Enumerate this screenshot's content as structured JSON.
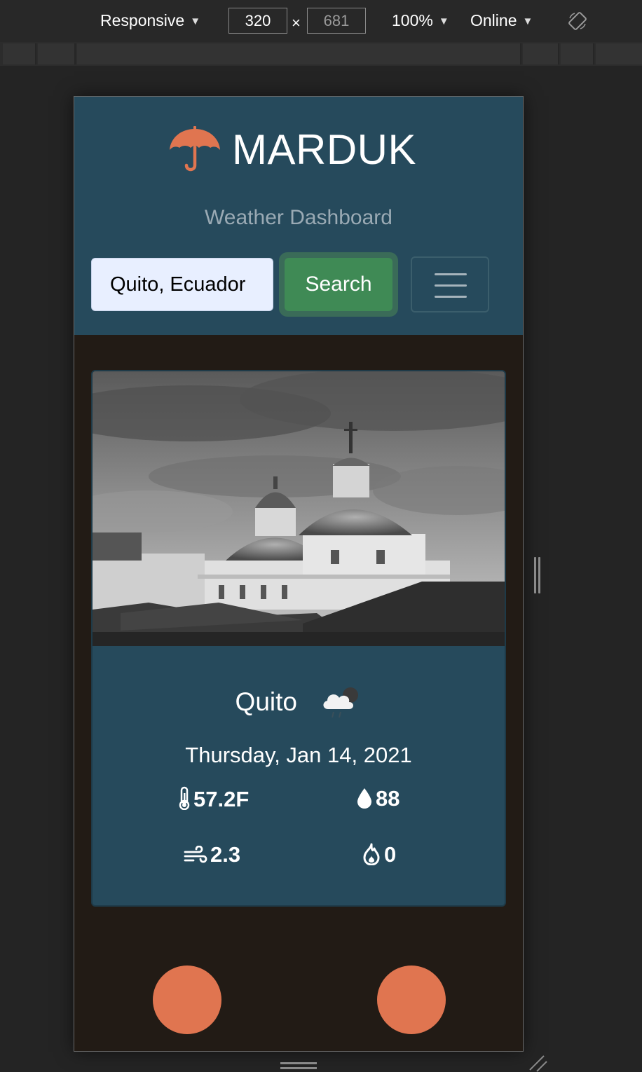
{
  "devtools": {
    "device_mode": "Responsive",
    "width": "320",
    "height": "681",
    "times": "×",
    "zoom": "100%",
    "network": "Online",
    "rotate_icon": "rotate-icon",
    "caret_icon": "▼"
  },
  "header": {
    "logo_icon": "umbrella-icon",
    "brand": "MARDUK",
    "subtitle": "Weather Dashboard",
    "search_value": "Quito, Ecuador",
    "search_button": "Search",
    "menu_icon": "hamburger-icon"
  },
  "weather": {
    "city": "Quito",
    "condition_icon": "cloud-rain-icon",
    "date": "Thursday, Jan 14, 2021",
    "temperature": "57.2F",
    "humidity": "88",
    "wind": "2.3",
    "uv": "0"
  },
  "colors": {
    "header_bg": "#264a5c",
    "page_bg": "#221b15",
    "accent": "#e07550",
    "button_green": "#3f8a55"
  }
}
